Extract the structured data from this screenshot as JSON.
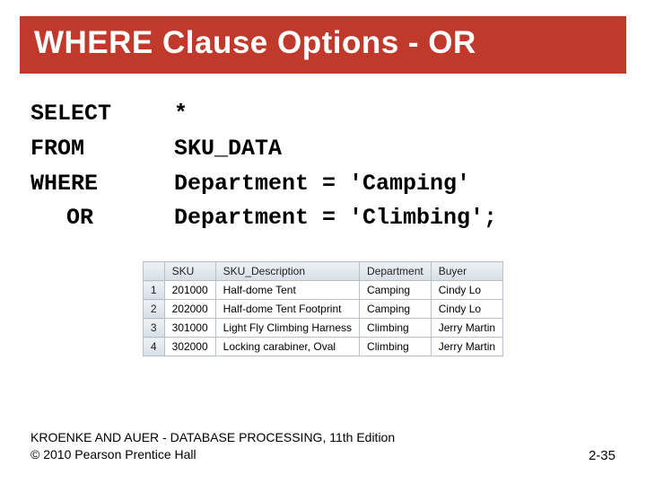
{
  "title": "WHERE Clause Options - OR",
  "sql": {
    "k_select": "SELECT",
    "v_select": "*",
    "k_from": "FROM",
    "v_from": "SKU_DATA",
    "k_where": "WHERE",
    "v_where": "Department = 'Camping'",
    "k_or": "OR",
    "v_or": "Department = 'Climbing';"
  },
  "table": {
    "headers": [
      "SKU",
      "SKU_Description",
      "Department",
      "Buyer"
    ],
    "rows": [
      {
        "n": "1",
        "sku": "201000",
        "desc": "Half-dome Tent",
        "dept": "Camping",
        "buyer": "Cindy Lo"
      },
      {
        "n": "2",
        "sku": "202000",
        "desc": "Half-dome Tent Footprint",
        "dept": "Camping",
        "buyer": "Cindy Lo"
      },
      {
        "n": "3",
        "sku": "301000",
        "desc": "Light Fly Climbing Harness",
        "dept": "Climbing",
        "buyer": "Jerry Martin"
      },
      {
        "n": "4",
        "sku": "302000",
        "desc": "Locking carabiner, Oval",
        "dept": "Climbing",
        "buyer": "Jerry Martin"
      }
    ]
  },
  "footer": {
    "line1": "KROENKE AND AUER - DATABASE PROCESSING, 11th Edition",
    "line2": "© 2010 Pearson Prentice Hall",
    "page": "2-35"
  }
}
